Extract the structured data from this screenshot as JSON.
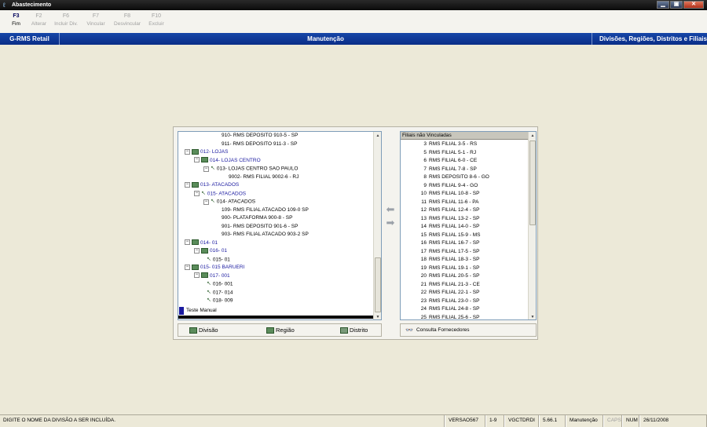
{
  "window": {
    "title": "Abastecimento",
    "btn_min": "▁",
    "btn_max": "▣",
    "btn_close": "✕"
  },
  "toolbar": [
    {
      "key": "F3",
      "label": "Fim",
      "enabled": true
    },
    {
      "key": "F2",
      "label": "Alterar",
      "enabled": false
    },
    {
      "key": "F6",
      "label": "Incluir Div.",
      "enabled": false
    },
    {
      "key": "F7",
      "label": "Vincular",
      "enabled": false
    },
    {
      "key": "F8",
      "label": "Desvincular",
      "enabled": false
    },
    {
      "key": "F10",
      "label": "Excluir",
      "enabled": false
    }
  ],
  "header": {
    "app": "G-RMS Retail",
    "module": "Manutenção",
    "screen": "Divisões, Regiões, Distritos e Filiais"
  },
  "tree": {
    "nodes": [
      {
        "text": "910- RMS DEPOSITO 910-5 - SP"
      },
      {
        "text": "911- RMS DEPOSITO 911-3 - SP"
      },
      {
        "text": "012- LOJAS"
      },
      {
        "text": "014- LOJAS CENTRO"
      },
      {
        "text": "013- LOJAS CENTRO SAO PAULO"
      },
      {
        "text": "9002- RMS FILIAL 9002-6 - RJ"
      },
      {
        "text": "013- ATACADOS"
      },
      {
        "text": "015- ATACADOS"
      },
      {
        "text": "014- ATACADOS"
      },
      {
        "text": "109- RMS FILIAL ATACADO 109-0 SP"
      },
      {
        "text": "900- PLATAFORMA 900-8 - SP"
      },
      {
        "text": "901- RMS DEPOSITO 901-6 - SP"
      },
      {
        "text": "903- RMS FILIAL ATACADO 903-2 SP"
      },
      {
        "text": "014- 01"
      },
      {
        "text": "016- 01"
      },
      {
        "text": "015- 01"
      },
      {
        "text": "015- 015 BARUERI"
      },
      {
        "text": "017- 001"
      },
      {
        "text": "016- 001"
      },
      {
        "text": "017- 014"
      },
      {
        "text": "018- 009"
      },
      {
        "text": "Teste Manual"
      }
    ]
  },
  "list": {
    "header": "Filiais não Vinculadas",
    "rows": [
      {
        "num": "3",
        "name": "RMS FILIAL 3-5 - RS"
      },
      {
        "num": "5",
        "name": "RMS FILIAL 5-1 - RJ"
      },
      {
        "num": "6",
        "name": "RMS FILIAL 6-0 - CE"
      },
      {
        "num": "7",
        "name": "RMS FILIAL 7-8 - SP"
      },
      {
        "num": "8",
        "name": "RMS DEPOSITO 8-6 - GO"
      },
      {
        "num": "9",
        "name": "RMS FILIAL 9-4 - GO"
      },
      {
        "num": "10",
        "name": "RMS FILIAL 10-8 - SP"
      },
      {
        "num": "11",
        "name": "RMS FILIAL 11-6 - PA"
      },
      {
        "num": "12",
        "name": "RMS FILIAL 12-4 - SP"
      },
      {
        "num": "13",
        "name": "RMS FILIAL 13-2 - SP"
      },
      {
        "num": "14",
        "name": "RMS FILIAL 14-0 - SP"
      },
      {
        "num": "15",
        "name": "RMS FILIAL 15-9 - MS"
      },
      {
        "num": "16",
        "name": "RMS FILIAL 16-7 - SP"
      },
      {
        "num": "17",
        "name": "RMS FILIAL 17-5 - SP"
      },
      {
        "num": "18",
        "name": "RMS FILIAL 18-3 - SP"
      },
      {
        "num": "19",
        "name": "RMS FILIAL 19-1 - SP"
      },
      {
        "num": "20",
        "name": "RMS FILIAL 20-5 - SP"
      },
      {
        "num": "21",
        "name": "RMS FILIAL 21-3 - CE"
      },
      {
        "num": "22",
        "name": "RMS FILIAL 22-1 - SP"
      },
      {
        "num": "23",
        "name": "RMS FILIAL 23-0 - SP"
      },
      {
        "num": "24",
        "name": "RMS FILIAL 24-8 - SP"
      },
      {
        "num": "25",
        "name": "RMS FILIAL 25-6 - SP"
      }
    ]
  },
  "buttons": {
    "divisao": "Divisão",
    "regiao": "Região",
    "distrito": "Distrito",
    "consulta": "Consulta Fornecedores"
  },
  "status": {
    "message": "DIGITE O NOME DA DIVISÃO A SER INCLUÍDA.",
    "version": "VERSAO567",
    "page": "1-9",
    "program": "VGCTDRDI",
    "build": "5.66.1",
    "mode": "Manutenção",
    "caps": "CAPS",
    "num": "NUM",
    "date": "26/11/2008"
  }
}
